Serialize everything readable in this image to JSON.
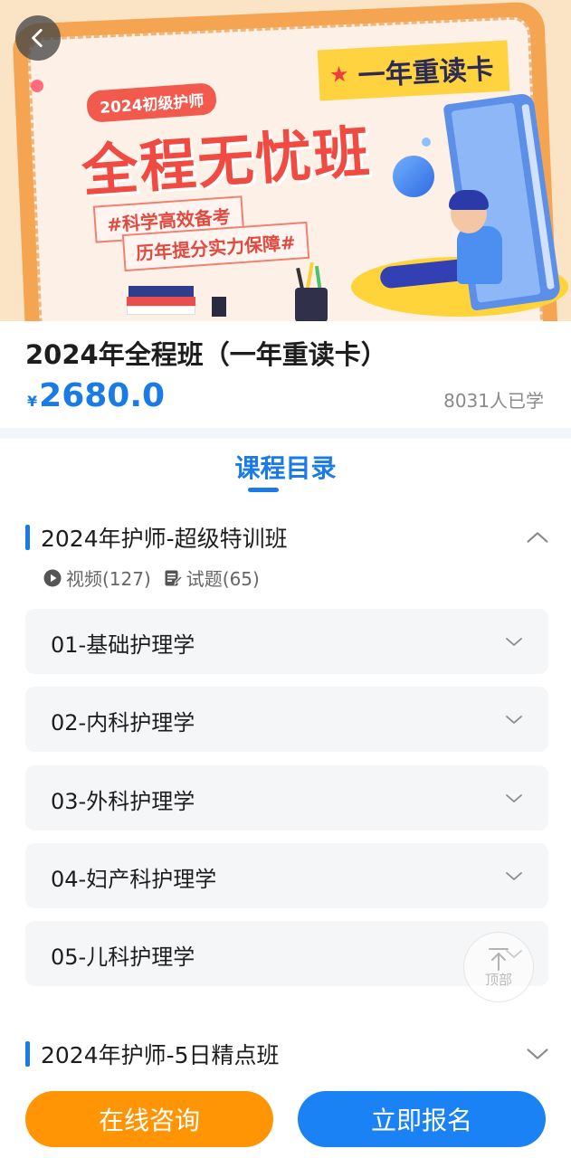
{
  "banner": {
    "year_pill": "2024初级护师",
    "title": "全程无忧班",
    "tag1": "#科学高效备考",
    "tag2": "历年提分实力保障#",
    "reread_badge": "一年重读卡"
  },
  "course": {
    "title": "2024年全程班（一年重读卡）",
    "currency": "¥",
    "price": "2680.0",
    "learners": "8031人已学"
  },
  "catalog": {
    "tab_label": "课程目录",
    "sections": [
      {
        "title": "2024年护师-超级特训班",
        "expanded": true,
        "video_label": "视频(127)",
        "quiz_label": "试题(65)",
        "chapters": [
          {
            "label": "01-基础护理学"
          },
          {
            "label": "02-内科护理学"
          },
          {
            "label": "03-外科护理学"
          },
          {
            "label": "04-妇产科护理学"
          },
          {
            "label": "05-儿科护理学"
          }
        ]
      },
      {
        "title": "2024年护师-5日精点班",
        "expanded": false
      }
    ]
  },
  "to_top_label": "顶部",
  "buttons": {
    "consult": "在线咨询",
    "enroll": "立即报名"
  },
  "colors": {
    "accent_blue": "#1a7be8",
    "consult_orange": "#ff9505",
    "enroll_blue": "#1a82f5"
  }
}
